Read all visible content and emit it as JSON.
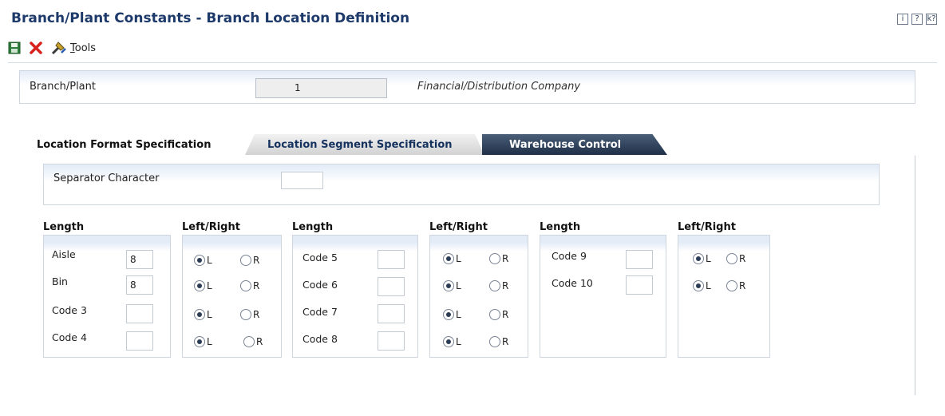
{
  "header": {
    "title": "Branch/Plant Constants - Branch Location Definition",
    "help_icons": [
      {
        "icon": "info-icon",
        "glyph": "i"
      },
      {
        "icon": "help-icon",
        "glyph": "?"
      },
      {
        "icon": "whats-this-icon",
        "glyph": "k?"
      }
    ]
  },
  "toolbar": {
    "save_icon": "save-icon",
    "cancel_icon": "close-icon",
    "tools_icon": "tools-icon",
    "tools_label_first": "T",
    "tools_label_rest": "ools"
  },
  "branch_plant": {
    "label": "Branch/Plant",
    "value": "1",
    "description": "Financial/Distribution Company"
  },
  "tabs": {
    "active": "Location Format Specification",
    "segment": "Location Segment Specification",
    "warehouse": "Warehouse Control"
  },
  "separator": {
    "label": "Separator Character",
    "value": ""
  },
  "groups": {
    "length_header": "Length",
    "leftright_header": "Left/Right",
    "radio_left": "L",
    "radio_right": "R",
    "col1": [
      {
        "label": "Aisle",
        "length": "8",
        "align": "L"
      },
      {
        "label": "Bin",
        "length": "8",
        "align": "L"
      },
      {
        "label": "Code 3",
        "length": "",
        "align": "L"
      },
      {
        "label": "Code 4",
        "length": "",
        "align": "L"
      }
    ],
    "col2": [
      {
        "label": "Code 5",
        "length": "",
        "align": "L"
      },
      {
        "label": "Code 6",
        "length": "",
        "align": "L"
      },
      {
        "label": "Code 7",
        "length": "",
        "align": "L"
      },
      {
        "label": "Code 8",
        "length": "",
        "align": "L"
      }
    ],
    "col3": [
      {
        "label": "Code 9",
        "length": "",
        "align": "L"
      },
      {
        "label": "Code 10",
        "length": "",
        "align": "L"
      }
    ]
  },
  "colors": {
    "title": "#1d3a6b",
    "panel_gradient": "#e3ebf7",
    "active_tab": "#1f2f47"
  }
}
